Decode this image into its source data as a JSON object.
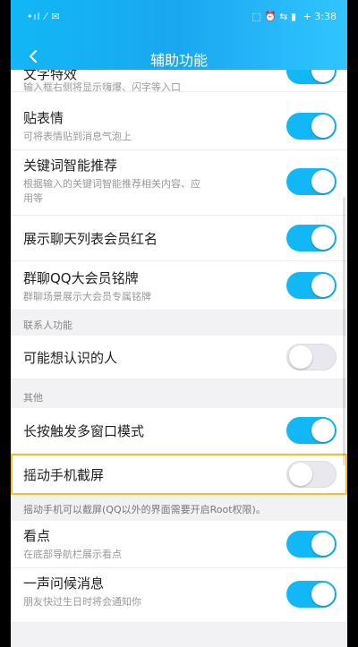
{
  "status_bar": {
    "left": "•ıl ⁄ ✉",
    "right_icons": "⬚ ⏰ ⇆ ▮",
    "time": "+ 3:38"
  },
  "header": {
    "title": "辅助功能"
  },
  "items": [
    {
      "main": "文字特效",
      "sub": "输入框右侧将显示嗨爆、闪字等入口",
      "on": true
    },
    {
      "main": "贴表情",
      "sub": "可将表情贴到消息气泡上",
      "on": true
    },
    {
      "main": "关键词智能推荐",
      "sub": "根据输入的关键词智能推荐相关内容、应",
      "sub2": "用等",
      "on": true
    },
    {
      "main": "展示聊天列表会员红名",
      "on": true
    },
    {
      "main": "群聊QQ大会员铭牌",
      "sub": "群聊场景展示大会员专属铭牌",
      "on": true
    }
  ],
  "section_contacts": "联系人功能",
  "contacts": [
    {
      "main": "可能想认识的人",
      "on": false
    }
  ],
  "section_other": "其他",
  "other": [
    {
      "main": "长按触发多窗口模式",
      "on": true
    },
    {
      "main": "摇动手机截屏",
      "on": false
    }
  ],
  "shake_note": "摇动手机可以截屏(QQ以外的界面需要开启Root权限)。",
  "bottom": [
    {
      "main": "看点",
      "sub": "在底部导航栏展示看点",
      "on": true
    },
    {
      "main": "一声问候消息",
      "sub": "朋友快过生日时将会通知你",
      "on": true
    }
  ],
  "colors": {
    "accent": "#12b7f5",
    "highlight": "#f4c224"
  }
}
